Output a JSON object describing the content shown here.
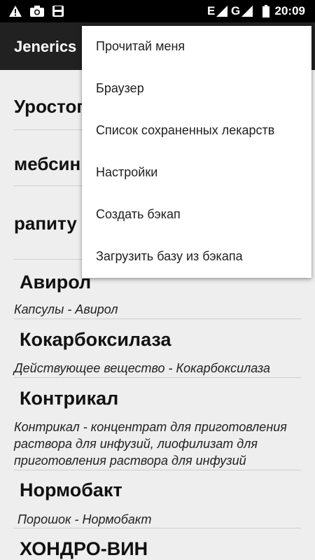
{
  "status_bar": {
    "time": "20:09",
    "network_label": "E",
    "roaming_label": "G",
    "icons": [
      "warning-icon",
      "camera-icon",
      "sd-card-icon",
      "signal-icon",
      "battery-icon"
    ]
  },
  "app_bar": {
    "title": "Jenerics"
  },
  "search_rows": [
    {
      "text": "Уростоп"
    },
    {
      "text": "мебсин"
    },
    {
      "text": "рапиту"
    }
  ],
  "drugs": [
    {
      "name": "Авирол",
      "description": "Капсулы - Авирол"
    },
    {
      "name": "Кокарбоксилаза",
      "description": "Действующее вещество - Кокарбоксилаза"
    },
    {
      "name": "Контрикал",
      "description": "Контрикал - концентрат для приготовления раствора для инфузий, лиофилизат для приготовления раствора для инфузий"
    },
    {
      "name": "Нормобакт",
      "description": "Порошок - Нормобакт"
    },
    {
      "name": "ХОНДРО-ВИН",
      "description": ""
    }
  ],
  "menu": {
    "items": [
      {
        "label": "Прочитай меня"
      },
      {
        "label": "Браузер"
      },
      {
        "label": "Список сохраненных лекарств"
      },
      {
        "label": "Настройки"
      },
      {
        "label": "Создать бэкап"
      },
      {
        "label": "Загрузить базу из бэкапа"
      }
    ]
  },
  "colors": {
    "status_bar": "#000000",
    "app_bar": "#212121",
    "background": "#eeeeee",
    "menu_background": "#ffffff"
  }
}
